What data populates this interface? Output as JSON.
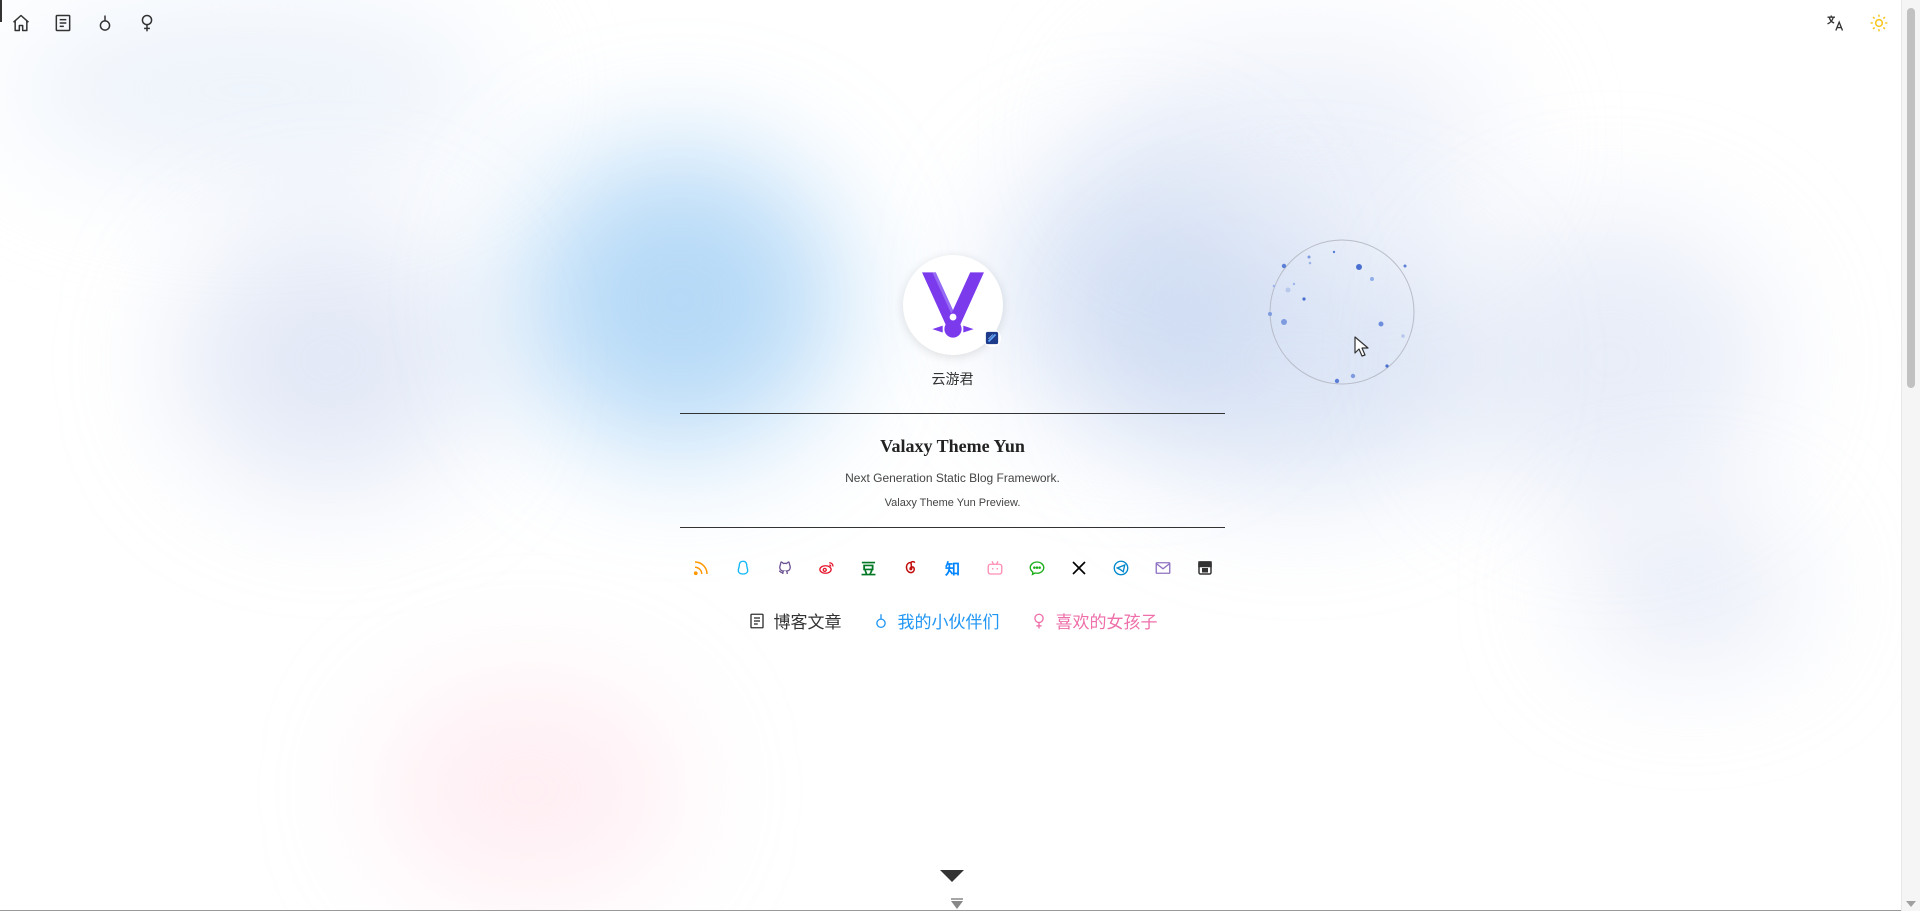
{
  "topbar": {
    "left_icons": [
      "home-icon",
      "document-icon",
      "male-icon",
      "female-icon"
    ],
    "right_icons": [
      "translate-icon",
      "sun-icon"
    ]
  },
  "profile": {
    "author_name": "云游君",
    "site_title": "Valaxy Theme Yun",
    "subtitle": "Next Generation Static Blog Framework.",
    "description": "Valaxy Theme Yun Preview."
  },
  "social_links": [
    {
      "name": "rss-icon",
      "color": "#ff9800"
    },
    {
      "name": "qq-icon",
      "color": "#12b7f5"
    },
    {
      "name": "github-icon",
      "color": "#6e5494"
    },
    {
      "name": "weibo-icon",
      "color": "#e6162d"
    },
    {
      "name": "douban-icon",
      "color": "#007722",
      "glyph": "豆"
    },
    {
      "name": "netease-music-icon",
      "color": "#c20c0c"
    },
    {
      "name": "zhihu-icon",
      "color": "#0084ff",
      "glyph": "知"
    },
    {
      "name": "bilibili-icon",
      "color": "#ff8eb3"
    },
    {
      "name": "wechat-icon",
      "color": "#1aad19"
    },
    {
      "name": "x-icon",
      "color": "#000000",
      "glyph": "𝕏"
    },
    {
      "name": "telegram-icon",
      "color": "#0088cc"
    },
    {
      "name": "email-icon",
      "color": "#8e71c1"
    },
    {
      "name": "travelling-icon",
      "color": "#333333"
    }
  ],
  "nav_links": [
    {
      "label": "博客文章",
      "color": "#333333",
      "icon": "document-icon"
    },
    {
      "label": "我的小伙伴们",
      "color": "#2196f3",
      "icon": "male-icon"
    },
    {
      "label": "喜欢的女孩子",
      "color": "#ee6fa9",
      "icon": "female-icon"
    }
  ],
  "colors": {
    "avatar_purple": "#7c3aed",
    "avatar_light": "#a78bfa",
    "sun_yellow": "#f5c518"
  }
}
